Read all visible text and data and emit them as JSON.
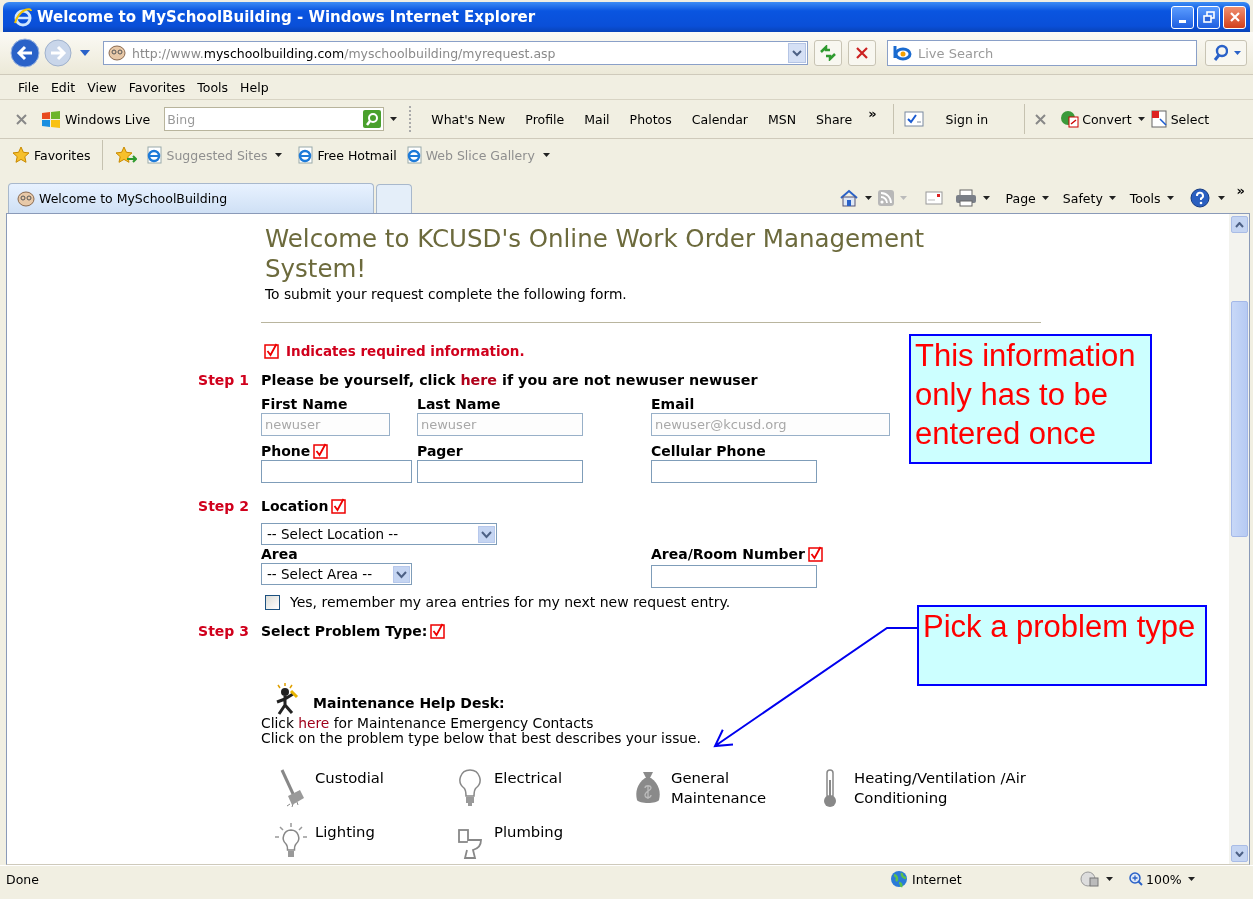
{
  "window": {
    "title": "Welcome to MySchoolBuilding - Windows Internet Explorer"
  },
  "address_bar": {
    "url": "http://www.**myschoolbuilding.com**/myschoolbuilding/myrequest.asp"
  },
  "search": {
    "placeholder": "Live Search"
  },
  "menu": [
    "File",
    "Edit",
    "View",
    "Favorites",
    "Tools",
    "Help"
  ],
  "live_toolbar": {
    "brand": "Windows Live",
    "search_placeholder": "Bing",
    "links": [
      "What's New",
      "Profile",
      "Mail",
      "Photos",
      "Calendar",
      "MSN",
      "Share"
    ],
    "more": "»",
    "sign_in": "Sign in",
    "convert": "Convert",
    "select": "Select"
  },
  "favorites_bar": {
    "label": "Favorites",
    "items": [
      {
        "label": "Suggested Sites",
        "dimmed": true,
        "dropdown": true
      },
      {
        "label": "Free Hotmail",
        "dimmed": false,
        "dropdown": false
      },
      {
        "label": "Web Slice Gallery",
        "dimmed": true,
        "dropdown": true
      }
    ]
  },
  "tabs": [
    {
      "label": "Welcome to MySchoolBuilding",
      "selected": true
    }
  ],
  "command_bar": {
    "items": [
      "Page",
      "Safety",
      "Tools"
    ],
    "more": "»"
  },
  "page": {
    "heading": "Welcome to KCUSD's Online Work Order Management System!",
    "intro": "To submit your request complete the following form.",
    "required_note": "Indicates required information.",
    "step1": {
      "label": "Step 1",
      "prompt_before": "Please be yourself, click",
      "link": "here",
      "prompt_after": "if you are not newuser newuser",
      "fields": [
        {
          "label": "First Name",
          "value": "newuser",
          "disabled": true,
          "required": false
        },
        {
          "label": "Last Name",
          "value": "newuser",
          "disabled": true,
          "required": false
        },
        {
          "label": "Email",
          "value": "newuser@kcusd.org",
          "disabled": true,
          "required": false
        },
        {
          "label": "Phone",
          "disabled": false,
          "required": true
        },
        {
          "label": "Pager",
          "disabled": false,
          "required": false
        },
        {
          "label": "Cellular Phone",
          "disabled": false,
          "required": false
        }
      ]
    },
    "step2": {
      "label": "Step 2",
      "location": {
        "label": "Location",
        "required": true,
        "value": "-- Select Location --"
      },
      "area": {
        "label": "Area",
        "value": "-- Select Area --"
      },
      "room": {
        "label": "Area/Room Number",
        "required": true
      },
      "remember": {
        "label": "Yes, remember my area entries for my next new request entry.",
        "checked": false
      }
    },
    "step3": {
      "label": "Step 3",
      "prompt": "Select Problem Type:",
      "required": true
    },
    "help_desk": {
      "title": "Maintenance Help Desk:",
      "line1_before": "Click",
      "line1_link": "here",
      "line1_after": "for Maintenance Emergency Contacts",
      "line2": "Click on the problem type below that best describes your issue."
    },
    "problem_types": [
      {
        "label": "Custodial",
        "kind": "broom"
      },
      {
        "label": "Electrical",
        "kind": "bulb"
      },
      {
        "label": "General Maintenance",
        "kind": "bag"
      },
      {
        "label": "Heating/Ventilation /Air Conditioning",
        "kind": "thermometer"
      },
      {
        "label": "Lighting",
        "kind": "lit-bulb"
      },
      {
        "label": "Plumbing",
        "kind": "toilet"
      }
    ]
  },
  "callouts": [
    {
      "text": "This information only has to be entered once"
    },
    {
      "text": "Pick a problem type"
    }
  ],
  "status_bar": {
    "text": "Done",
    "zone": "Internet",
    "zoom": "100%"
  }
}
